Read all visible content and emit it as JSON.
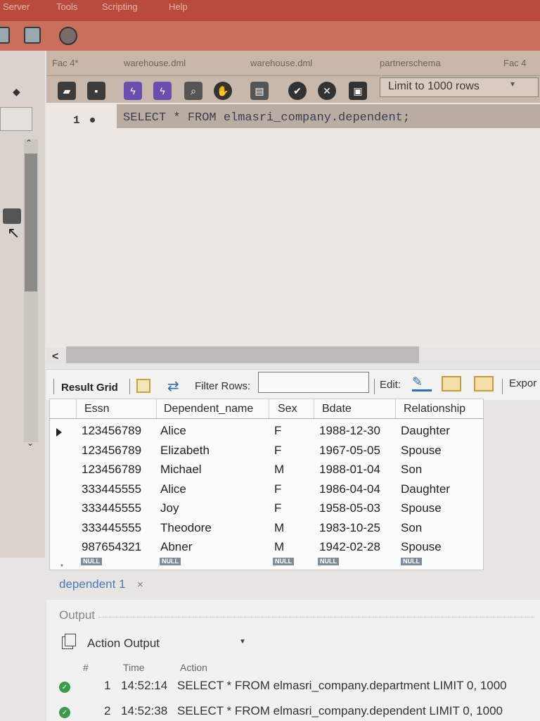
{
  "menu": {
    "items": [
      "Server",
      "Tools",
      "Scripting",
      "Help"
    ]
  },
  "tabs": [
    "Fac 4*",
    "warehouse.dml",
    "warehouse.dml",
    "partnerschema",
    "Fac 4"
  ],
  "editor_toolbar": {
    "limit_label": "Limit to 1000 rows"
  },
  "editor": {
    "line_number": "1",
    "sql": "SELECT * FROM elmasri_company.dependent;"
  },
  "result_toolbar": {
    "result_grid_label": "Result Grid",
    "filter_label": "Filter Rows:",
    "filter_value": "",
    "edit_label": "Edit:",
    "export_label": "Expor"
  },
  "grid": {
    "columns": [
      "Essn",
      "Dependent_name",
      "Sex",
      "Bdate",
      "Relationship"
    ],
    "rows": [
      [
        "123456789",
        "Alice",
        "F",
        "1988-12-30",
        "Daughter"
      ],
      [
        "123456789",
        "Elizabeth",
        "F",
        "1967-05-05",
        "Spouse"
      ],
      [
        "123456789",
        "Michael",
        "M",
        "1988-01-04",
        "Son"
      ],
      [
        "333445555",
        "Alice",
        "F",
        "1986-04-04",
        "Daughter"
      ],
      [
        "333445555",
        "Joy",
        "F",
        "1958-05-03",
        "Spouse"
      ],
      [
        "333445555",
        "Theodore",
        "M",
        "1983-10-25",
        "Son"
      ],
      [
        "987654321",
        "Abner",
        "M",
        "1942-02-28",
        "Spouse"
      ]
    ],
    "null_label": "NULL",
    "new_row_marker": "*"
  },
  "result_tab": {
    "label": "dependent 1",
    "close": "×"
  },
  "output": {
    "title": "Output",
    "selector": "Action Output",
    "headers": [
      "#",
      "Time",
      "Action"
    ],
    "rows": [
      {
        "n": "1",
        "time": "14:52:14",
        "action": "SELECT * FROM elmasri_company.department LIMIT 0, 1000"
      },
      {
        "n": "2",
        "time": "14:52:38",
        "action": "SELECT * FROM elmasri_company.dependent LIMIT 0, 1000"
      }
    ]
  },
  "colors": {
    "accent": "#4a7ab8",
    "ok": "#3c9b4b",
    "stop": "#c0392b"
  }
}
